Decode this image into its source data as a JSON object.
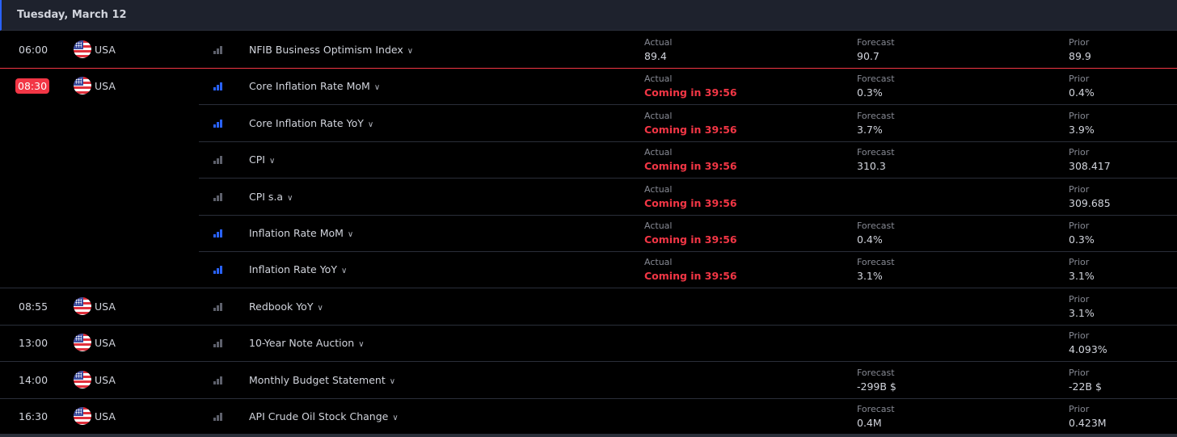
{
  "date_header": "Tuesday, March 12",
  "labels": {
    "actual": "Actual",
    "forecast": "Forecast",
    "prior": "Prior"
  },
  "colors": {
    "accent": "#2962ff",
    "alert": "#f23645",
    "background": "#000000",
    "header_bg": "#1e222d"
  },
  "events": [
    {
      "time": "06:00",
      "country": "USA",
      "importance": "low",
      "event": "NFIB Business Optimism Index",
      "actual": "89.4",
      "actual_coming": false,
      "forecast": "90.7",
      "prior": "89.9"
    },
    {
      "time": "08:30",
      "country": "USA",
      "importance": "high",
      "event": "Core Inflation Rate MoM",
      "actual": "Coming in 39:56",
      "actual_coming": true,
      "forecast": "0.3%",
      "prior": "0.4%"
    },
    {
      "time": "",
      "country": "",
      "importance": "high",
      "event": "Core Inflation Rate YoY",
      "actual": "Coming in 39:56",
      "actual_coming": true,
      "forecast": "3.7%",
      "prior": "3.9%"
    },
    {
      "time": "",
      "country": "",
      "importance": "low",
      "event": "CPI",
      "actual": "Coming in 39:56",
      "actual_coming": true,
      "forecast": "310.3",
      "prior": "308.417"
    },
    {
      "time": "",
      "country": "",
      "importance": "low",
      "event": "CPI s.a",
      "actual": "Coming in 39:56",
      "actual_coming": true,
      "forecast": "",
      "prior": "309.685"
    },
    {
      "time": "",
      "country": "",
      "importance": "high",
      "event": "Inflation Rate MoM",
      "actual": "Coming in 39:56",
      "actual_coming": true,
      "forecast": "0.4%",
      "prior": "0.3%"
    },
    {
      "time": "",
      "country": "",
      "importance": "high",
      "event": "Inflation Rate YoY",
      "actual": "Coming in 39:56",
      "actual_coming": true,
      "forecast": "3.1%",
      "prior": "3.1%"
    },
    {
      "time": "08:55",
      "country": "USA",
      "importance": "none",
      "event": "Redbook YoY",
      "actual": "",
      "actual_coming": false,
      "forecast": "",
      "prior": "3.1%"
    },
    {
      "time": "13:00",
      "country": "USA",
      "importance": "low",
      "event": "10-Year Note Auction",
      "actual": "",
      "actual_coming": false,
      "forecast": "",
      "prior": "4.093%"
    },
    {
      "time": "14:00",
      "country": "USA",
      "importance": "low",
      "event": "Monthly Budget Statement",
      "actual": "",
      "actual_coming": false,
      "forecast": "-299B $",
      "prior": "-22B $"
    },
    {
      "time": "16:30",
      "country": "USA",
      "importance": "low",
      "event": "API Crude Oil Stock Change",
      "actual": "",
      "actual_coming": false,
      "forecast": "0.4M",
      "prior": "0.423M"
    }
  ],
  "current_time_badge": "08:30",
  "icons": {
    "flag": "usa-flag-icon",
    "importance": "importance-bars-icon",
    "expand": "chevron-down-icon"
  }
}
